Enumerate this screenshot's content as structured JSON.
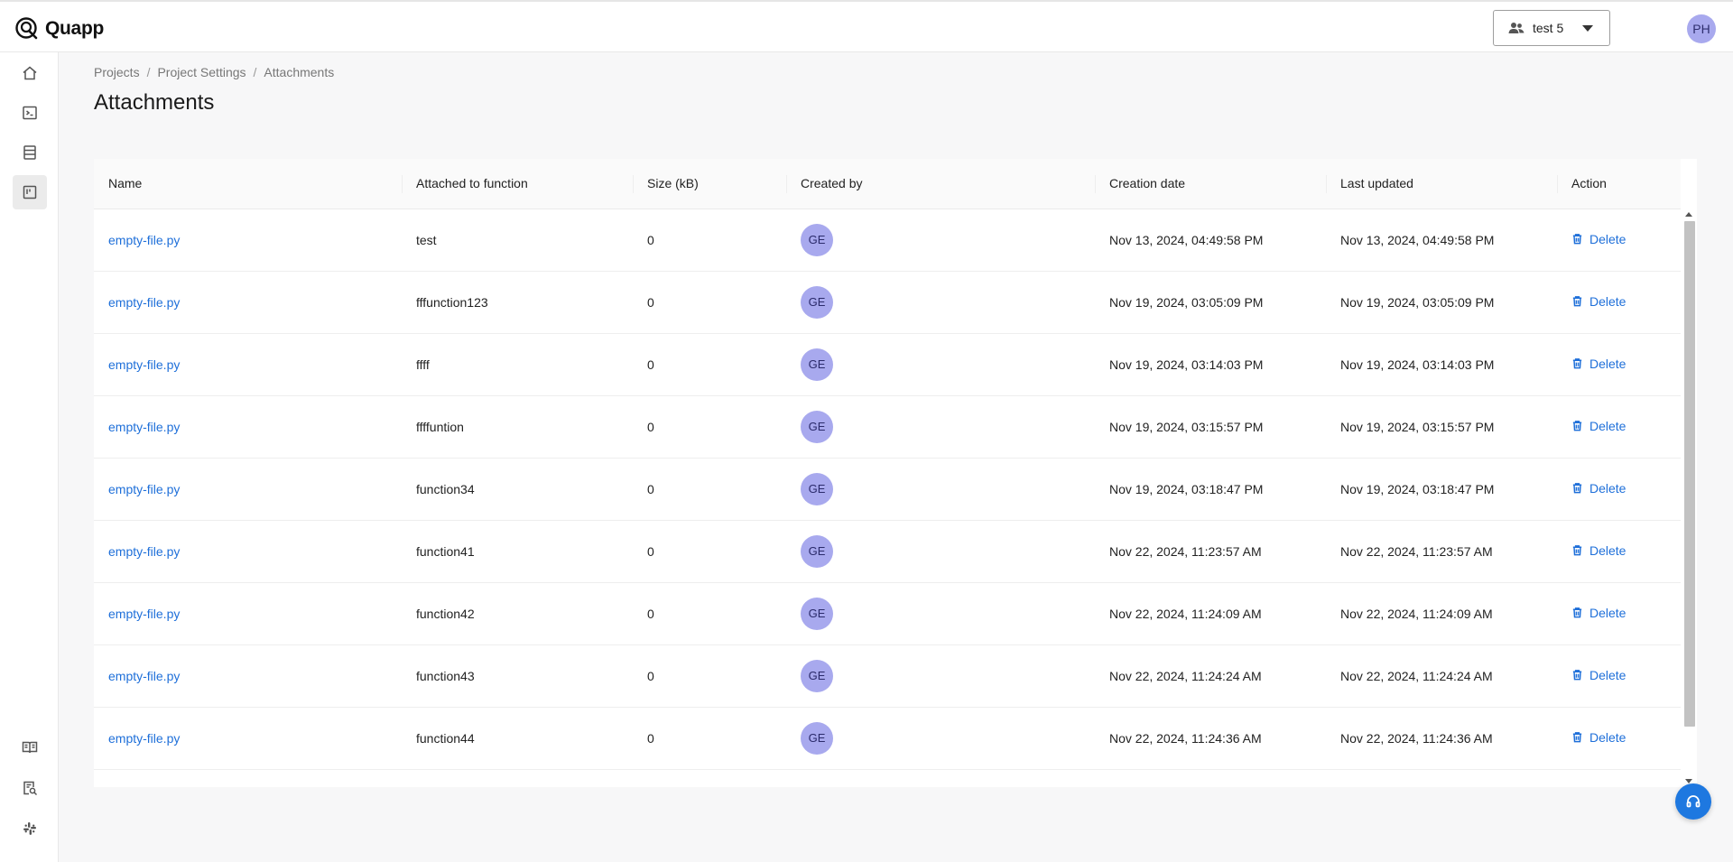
{
  "app": {
    "name": "Quapp"
  },
  "header": {
    "workspace_label": "test 5",
    "user_initials": "PH"
  },
  "breadcrumb": [
    "Projects",
    "Project Settings",
    "Attachments"
  ],
  "page": {
    "title": "Attachments"
  },
  "table": {
    "columns": [
      "Name",
      "Attached to function",
      "Size (kB)",
      "Created by",
      "Creation date",
      "Last updated",
      "Action"
    ],
    "rows": [
      {
        "name": "empty-file.py",
        "function": "test",
        "size": "0",
        "created_by": "GE",
        "created": "Nov 13, 2024, 04:49:58 PM",
        "updated": "Nov 13, 2024, 04:49:58 PM",
        "action": "Delete"
      },
      {
        "name": "empty-file.py",
        "function": "fffunction123",
        "size": "0",
        "created_by": "GE",
        "created": "Nov 19, 2024, 03:05:09 PM",
        "updated": "Nov 19, 2024, 03:05:09 PM",
        "action": "Delete"
      },
      {
        "name": "empty-file.py",
        "function": "ffff",
        "size": "0",
        "created_by": "GE",
        "created": "Nov 19, 2024, 03:14:03 PM",
        "updated": "Nov 19, 2024, 03:14:03 PM",
        "action": "Delete"
      },
      {
        "name": "empty-file.py",
        "function": "ffffuntion",
        "size": "0",
        "created_by": "GE",
        "created": "Nov 19, 2024, 03:15:57 PM",
        "updated": "Nov 19, 2024, 03:15:57 PM",
        "action": "Delete"
      },
      {
        "name": "empty-file.py",
        "function": "function34",
        "size": "0",
        "created_by": "GE",
        "created": "Nov 19, 2024, 03:18:47 PM",
        "updated": "Nov 19, 2024, 03:18:47 PM",
        "action": "Delete"
      },
      {
        "name": "empty-file.py",
        "function": "function41",
        "size": "0",
        "created_by": "GE",
        "created": "Nov 22, 2024, 11:23:57 AM",
        "updated": "Nov 22, 2024, 11:23:57 AM",
        "action": "Delete"
      },
      {
        "name": "empty-file.py",
        "function": "function42",
        "size": "0",
        "created_by": "GE",
        "created": "Nov 22, 2024, 11:24:09 AM",
        "updated": "Nov 22, 2024, 11:24:09 AM",
        "action": "Delete"
      },
      {
        "name": "empty-file.py",
        "function": "function43",
        "size": "0",
        "created_by": "GE",
        "created": "Nov 22, 2024, 11:24:24 AM",
        "updated": "Nov 22, 2024, 11:24:24 AM",
        "action": "Delete"
      },
      {
        "name": "empty-file.py",
        "function": "function44",
        "size": "0",
        "created_by": "GE",
        "created": "Nov 22, 2024, 11:24:36 AM",
        "updated": "Nov 22, 2024, 11:24:36 AM",
        "action": "Delete"
      }
    ]
  },
  "icons": {
    "sidebar": [
      "home-icon",
      "terminal-icon",
      "server-icon",
      "board-icon",
      "docs-icon",
      "search-document-icon",
      "slack-icon"
    ],
    "help": "headset-icon",
    "delete": "trash-icon",
    "workspace": "users-icon"
  },
  "colors": {
    "accent": "#1e6fd9",
    "avatar": "#a8a9ee",
    "help_button": "#1e78e0"
  }
}
